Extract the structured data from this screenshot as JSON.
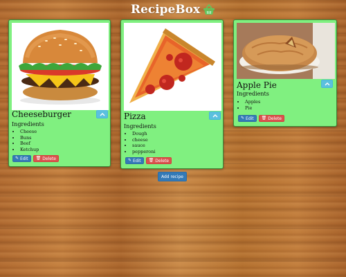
{
  "header": {
    "title": "RecipeBox",
    "icon": "basket-icon"
  },
  "recipes": [
    {
      "name": "Cheeseburger",
      "image": "cheeseburger-image",
      "ingredients_label": "Ingredients",
      "ingredients": [
        "Cheese",
        "Buns",
        "Beef",
        "Ketchup"
      ],
      "edit_label": "Edit",
      "delete_label": "Delete"
    },
    {
      "name": "Pizza",
      "image": "pizza-image",
      "ingredients_label": "Ingredients",
      "ingredients": [
        "Dough",
        "cheese",
        "sauce",
        "pepperoni"
      ],
      "edit_label": "Edit",
      "delete_label": "Delete"
    },
    {
      "name": "Apple Pie",
      "image": "apple-pie-image",
      "ingredients_label": "Ingredients",
      "ingredients": [
        "Apples",
        "Pie"
      ],
      "edit_label": "Edit",
      "delete_label": "Delete"
    }
  ],
  "add_recipe_label": "Add recipe",
  "colors": {
    "card_bg": "#80f080",
    "header_icon": "#5ec85e",
    "collapse_btn": "#5bc0de",
    "edit_btn": "#337ab7",
    "delete_btn": "#d9534f",
    "add_btn": "#337ab7"
  }
}
